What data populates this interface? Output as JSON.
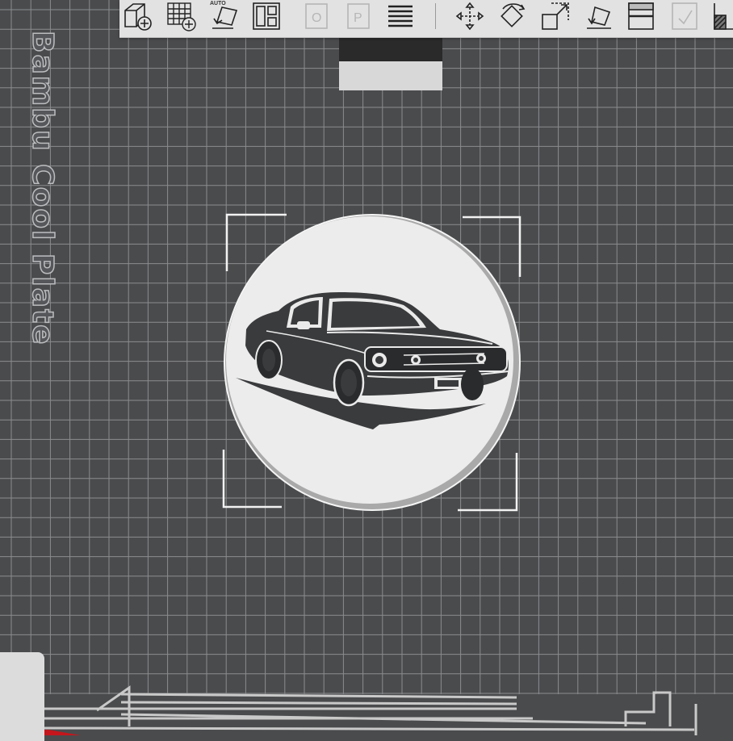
{
  "plate": {
    "label": "Bambu Cool Plate"
  },
  "toolbar": {
    "items": [
      {
        "name": "add-object-button",
        "icon": "cube-add-icon"
      },
      {
        "name": "add-plate-button",
        "icon": "grid-add-icon"
      },
      {
        "name": "auto-orient-button",
        "icon": "auto-orient-icon",
        "tag": "AUTO"
      },
      {
        "name": "arrange-button",
        "icon": "arrange-icon"
      },
      {
        "name": "split-objects-button",
        "icon": "split-objects-icon",
        "disabled": true
      },
      {
        "name": "split-parts-button",
        "icon": "split-parts-icon",
        "disabled": true
      },
      {
        "name": "variable-layer-button",
        "icon": "layers-icon"
      },
      {
        "name": "move-tool-button",
        "icon": "move-icon"
      },
      {
        "name": "rotate-tool-button",
        "icon": "rotate-icon"
      },
      {
        "name": "scale-tool-button",
        "icon": "scale-icon"
      },
      {
        "name": "lay-on-face-button",
        "icon": "lay-on-face-icon"
      },
      {
        "name": "cut-tool-button",
        "icon": "cut-icon"
      },
      {
        "name": "support-paint-button",
        "icon": "support-paint-icon",
        "disabled": true
      },
      {
        "name": "color-paint-button",
        "icon": "color-paint-icon"
      }
    ]
  },
  "model": {
    "name": "mustang-coaster",
    "icon": "classic-car-icon"
  },
  "colors": {
    "bed": "#4a4b4d",
    "grid": "#8a8c8e",
    "toolbar": "#e2e2e2",
    "disc": "#ececec",
    "car": "#3a3b3d",
    "selection": "#f2f2f2"
  }
}
